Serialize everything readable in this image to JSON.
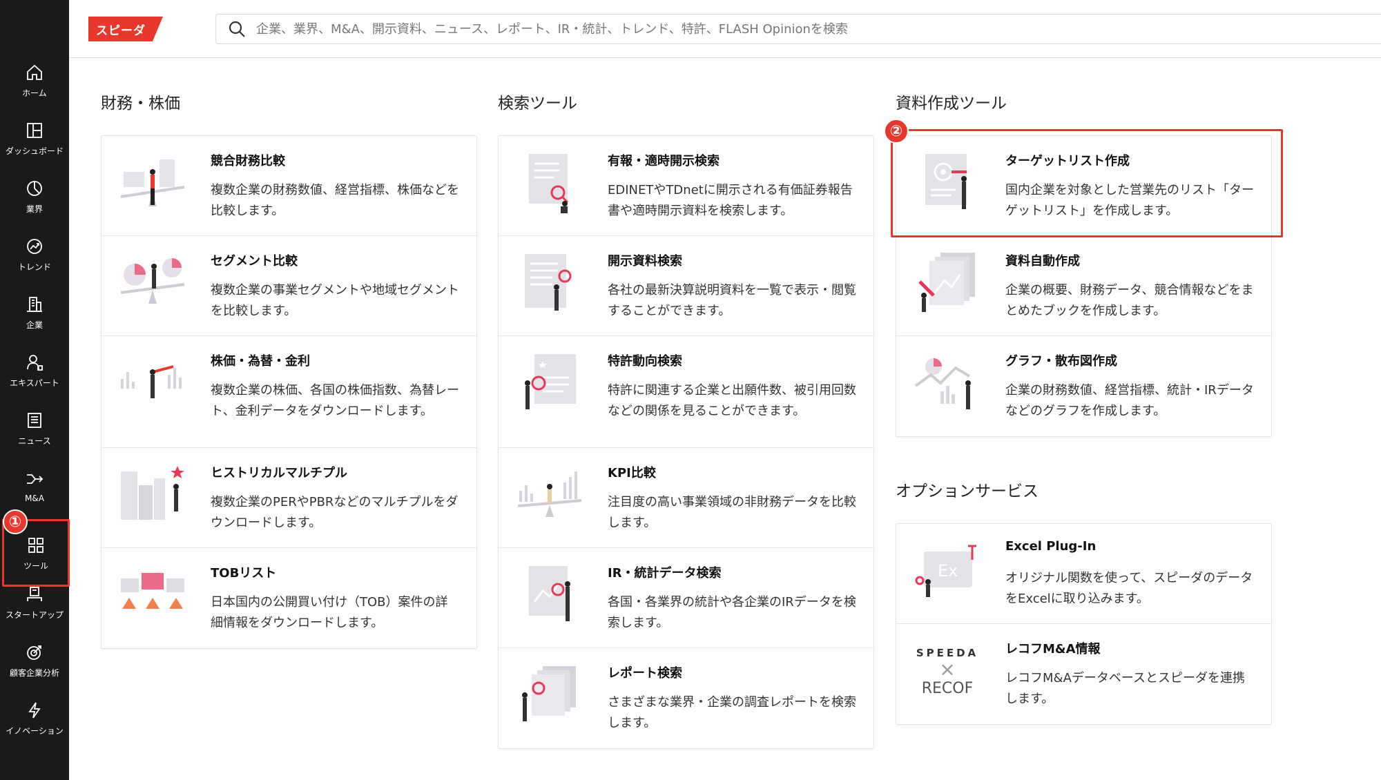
{
  "app": {
    "logo": "スピーダ"
  },
  "search": {
    "placeholder": "企業、業界、M&A、開示資料、ニュース、レポート、IR・統計、トレンド、特許、FLASH Opinionを検索"
  },
  "sidebar": {
    "items": [
      {
        "label": "ホーム",
        "icon": "home-icon"
      },
      {
        "label": "ダッシュボード",
        "icon": "dashboard-icon"
      },
      {
        "label": "業界",
        "icon": "pie-chart-icon"
      },
      {
        "label": "トレンド",
        "icon": "trend-icon"
      },
      {
        "label": "企業",
        "icon": "building-icon"
      },
      {
        "label": "エキスパート",
        "icon": "expert-icon"
      },
      {
        "label": "ニュース",
        "icon": "news-icon"
      },
      {
        "label": "M&A",
        "icon": "merge-icon"
      },
      {
        "label": "ツール",
        "icon": "grid-icon",
        "active": true
      },
      {
        "label": "スタートアップ",
        "icon": "startup-icon"
      },
      {
        "label": "顧客企業分析",
        "icon": "target-icon"
      },
      {
        "label": "イノベーション",
        "icon": "bolt-icon"
      }
    ]
  },
  "markers": {
    "one": "①",
    "two": "②"
  },
  "sections": {
    "finance": {
      "title": "財務・株価",
      "cards": [
        {
          "title": "競合財務比較",
          "desc": "複数企業の財務数値、経営指標、株価などを比較します。"
        },
        {
          "title": "セグメント比較",
          "desc": "複数企業の事業セグメントや地域セグメントを比較します。"
        },
        {
          "title": "株価・為替・金利",
          "desc": "複数企業の株価、各国の株価指数、為替レート、金利データをダウンロードします。"
        },
        {
          "title": "ヒストリカルマルチプル",
          "desc": "複数企業のPERやPBRなどのマルチプルをダウンロードします。"
        },
        {
          "title": "TOBリスト",
          "desc": "日本国内の公開買い付け（TOB）案件の詳細情報をダウンロードします。"
        }
      ]
    },
    "search_tools": {
      "title": "検索ツール",
      "cards": [
        {
          "title": "有報・適時開示検索",
          "desc": "EDINETやTDnetに開示される有価証券報告書や適時開示資料を検索します。"
        },
        {
          "title": "開示資料検索",
          "desc": "各社の最新決算説明資料を一覧で表示・閲覧することができます。"
        },
        {
          "title": "特許動向検索",
          "desc": "特許に関連する企業と出願件数、被引用回数などの関係を見ることができます。"
        },
        {
          "title": "KPI比較",
          "desc": "注目度の高い事業領域の非財務データを比較します。"
        },
        {
          "title": "IR・統計データ検索",
          "desc": "各国・各業界の統計や各企業のIRデータを検索します。"
        },
        {
          "title": "レポート検索",
          "desc": "さまざまな業界・企業の調査レポートを検索します。"
        }
      ]
    },
    "docs": {
      "title": "資料作成ツール",
      "cards": [
        {
          "title": "ターゲットリスト作成",
          "desc": "国内企業を対象とした営業先のリスト「ターゲットリスト」を作成します。"
        },
        {
          "title": "資料自動作成",
          "desc": "企業の概要、財務データ、競合情報などをまとめたブックを作成します。"
        },
        {
          "title": "グラフ・散布図作成",
          "desc": "企業の財務数値、経営指標、統計・IRデータなどのグラフを作成します。"
        }
      ]
    },
    "options": {
      "title": "オプションサービス",
      "cards": [
        {
          "title": "Excel Plug-In",
          "desc": "オリジナル関数を使って、スピーダのデータをExcelに取り込みます。",
          "badge": "Ex"
        },
        {
          "title": "レコフM&A情報",
          "desc": "レコフM&Aデータベースとスピーダを連携します。",
          "logo_top": "SPEEDA",
          "logo_bottom": "RECOF"
        }
      ]
    }
  }
}
